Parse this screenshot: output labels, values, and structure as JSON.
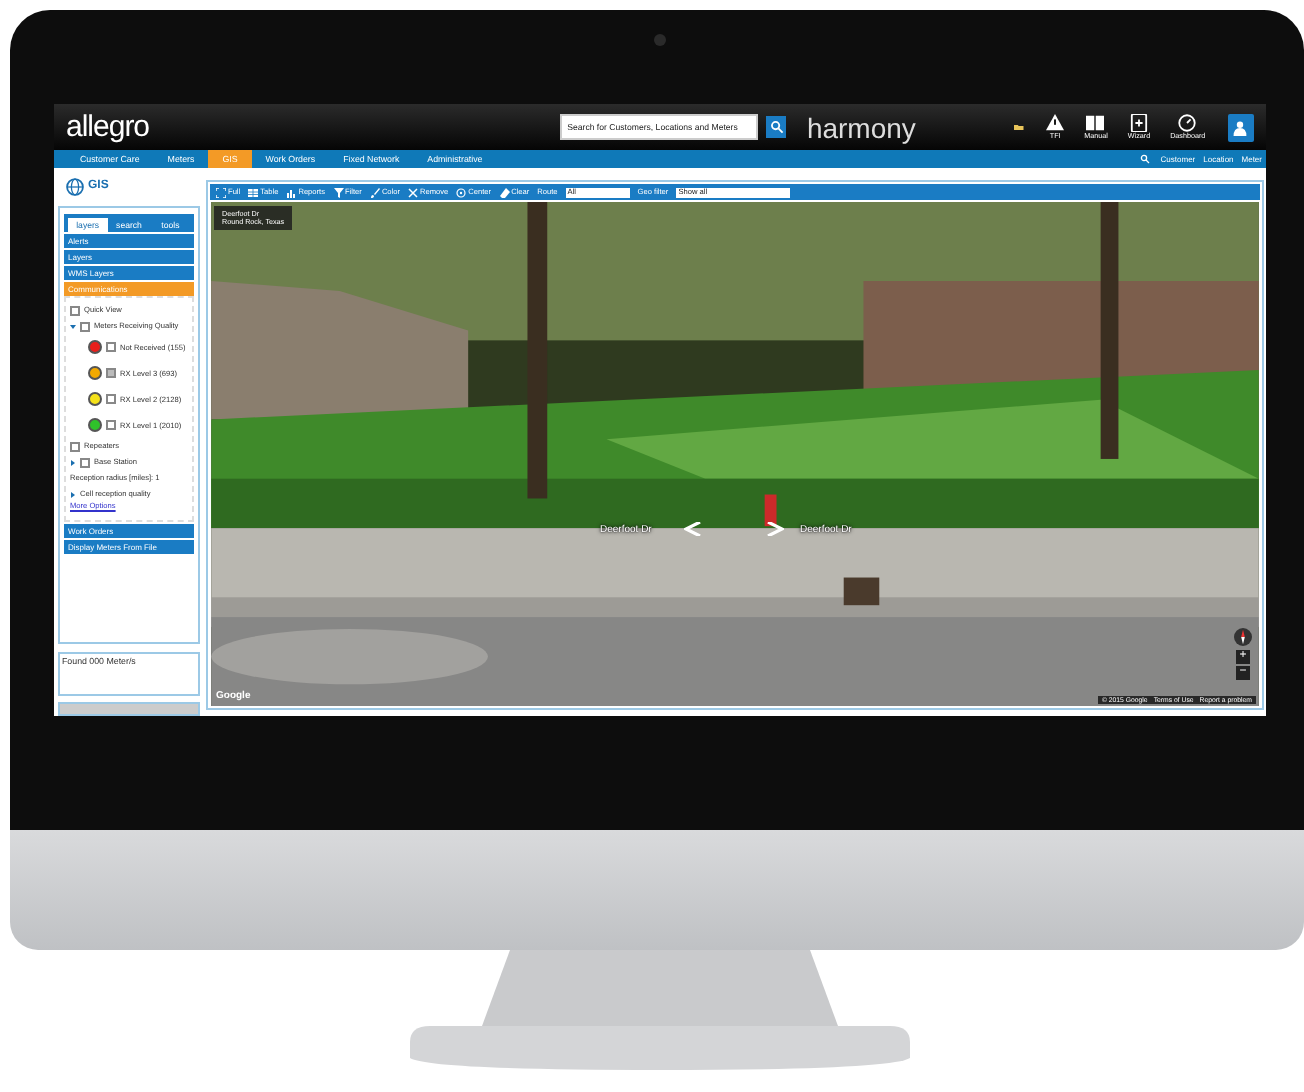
{
  "header": {
    "logo": "allegro",
    "search": {
      "placeholder": "Search for Customers, Locations and Meters"
    },
    "brand": "harmony",
    "tools": [
      {
        "label": "TFI",
        "kind": "alert"
      },
      {
        "label": "Manual",
        "kind": "book"
      },
      {
        "label": "Wizard",
        "kind": "wizard"
      },
      {
        "label": "Dashboard",
        "kind": "gauge"
      }
    ]
  },
  "nav": {
    "tabs": [
      {
        "label": "Customer Care",
        "selected": false
      },
      {
        "label": "Meters",
        "selected": false
      },
      {
        "label": "GIS",
        "selected": true
      },
      {
        "label": "Work Orders",
        "selected": false
      },
      {
        "label": "Fixed Network",
        "selected": false
      },
      {
        "label": "Administrative",
        "selected": false
      }
    ],
    "links": [
      "Customer",
      "Location",
      "Meter"
    ]
  },
  "sidebar": {
    "title": "GIS",
    "tabs": [
      {
        "label": "layers",
        "selected": true
      },
      {
        "label": "search",
        "selected": false
      },
      {
        "label": "tools",
        "selected": false
      }
    ],
    "sections": [
      {
        "label": "Alerts",
        "selected": false
      },
      {
        "label": "Layers",
        "selected": false
      },
      {
        "label": "WMS Layers",
        "selected": false
      },
      {
        "label": "Communications",
        "selected": true
      }
    ],
    "tree": [
      {
        "label": "Quick View",
        "checked": false
      },
      {
        "label": "Meters Receiving Quality",
        "checked": false,
        "expanded": true,
        "children": [
          {
            "label": "Not Received (155)",
            "checked": false,
            "color": "#e8201c"
          },
          {
            "label": "RX Level 3 (693)",
            "checked": true,
            "color": "#f2a900"
          },
          {
            "label": "RX Level 2 (2128)",
            "checked": false,
            "color": "#f5e21a"
          },
          {
            "label": "RX Level 1 (2010)",
            "checked": false,
            "color": "#2fc22a"
          }
        ]
      },
      {
        "label": "Repeaters",
        "checked": false
      },
      {
        "label": "Base Station",
        "checked": false,
        "expanded": false
      },
      {
        "label": "Reception radius [miles]: 1"
      },
      {
        "label": "Cell reception quality",
        "expanded": false
      }
    ],
    "more": "More Options",
    "bottom_sections": [
      "Work Orders",
      "Display Meters From File"
    ],
    "found": "Found 000 Meter/s"
  },
  "toolbar": {
    "buttons": [
      {
        "label": "Full",
        "kind": "expand"
      },
      {
        "label": "Table",
        "kind": "table"
      },
      {
        "label": "Reports",
        "kind": "chart"
      },
      {
        "label": "Filter",
        "kind": "filter"
      },
      {
        "label": "Color",
        "kind": "brush"
      },
      {
        "label": "Remove",
        "kind": "remove"
      },
      {
        "label": "Center",
        "kind": "target"
      },
      {
        "label": "Clear",
        "kind": "eraser"
      }
    ],
    "selects": [
      {
        "label": "Route",
        "value": "All"
      },
      {
        "label": "Geo filter",
        "value": "Show all"
      }
    ]
  },
  "street_view": {
    "card": {
      "title": "Deerfoot Dr",
      "subtitle": "Round Rock, Texas"
    },
    "street_labels": [
      "Deerfoot Dr",
      "Deerfoot Dr"
    ],
    "zoom": [
      "+",
      "−"
    ],
    "logo": "Google",
    "footer": [
      "© 2015 Google",
      "Terms of Use",
      "Report a problem"
    ]
  }
}
